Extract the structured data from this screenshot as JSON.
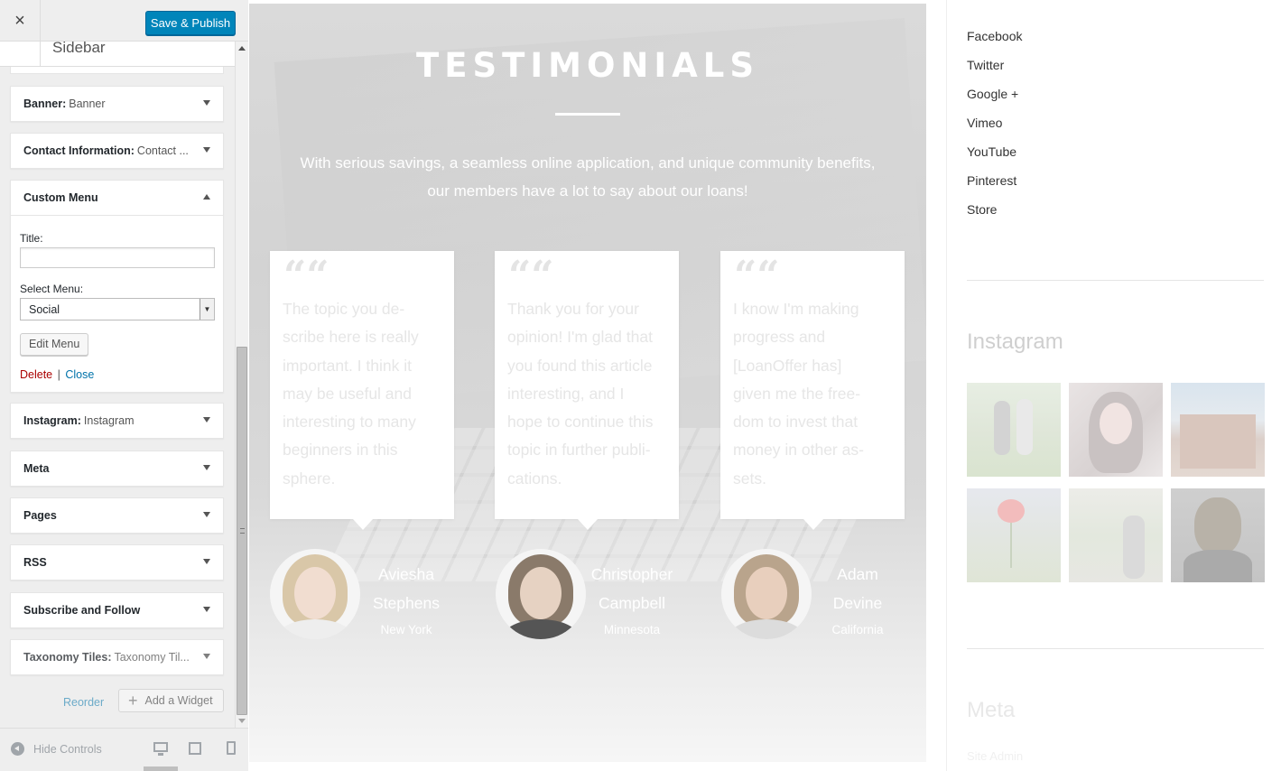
{
  "customizer": {
    "close_icon": "×",
    "publish_label": "Save & Publish",
    "section_title": "Sidebar",
    "widgets": [
      {
        "name": "Banner:",
        "subtitle": "Banner"
      },
      {
        "name": "Contact Information:",
        "subtitle": "Contact ..."
      },
      {
        "name": "Custom Menu",
        "subtitle": ""
      },
      {
        "name": "Instagram:",
        "subtitle": "Instagram"
      },
      {
        "name": "Meta",
        "subtitle": ""
      },
      {
        "name": "Pages",
        "subtitle": ""
      },
      {
        "name": "RSS",
        "subtitle": ""
      },
      {
        "name": "Subscribe and Follow",
        "subtitle": ""
      },
      {
        "name": "Taxonomy Tiles:",
        "subtitle": "Taxonomy Til..."
      }
    ],
    "custom_menu_form": {
      "title_label": "Title:",
      "title_value": "",
      "select_label": "Select Menu:",
      "select_value": "Social",
      "edit_menu_label": "Edit Menu",
      "delete_label": "Delete",
      "separator": "|",
      "close_label": "Close"
    },
    "reorder_label": "Reorder",
    "add_widget_label": "Add a Widget",
    "add_widget_icon": "+",
    "hide_controls_label": "Hide Controls"
  },
  "testimonials": {
    "title": "TESTIMONIALS",
    "intro_line1": "With serious savings, a seamless online application, and unique community benefits,",
    "intro_line2": "our members have a lot to say about our loans!",
    "quote_glyph": "““",
    "cards": [
      {
        "lines": [
          "The topic you de-",
          "scribe here is really",
          "important. I think it",
          "may be useful and",
          "interesting to many",
          "beginners in this",
          "sphere."
        ],
        "name_line1": "Aviesha",
        "name_line2": "Stephens",
        "location": "New York"
      },
      {
        "lines": [
          "Thank you for your",
          "opinion! I'm glad that",
          "you found this article",
          "interesting, and I",
          "hope to continue this",
          "topic in further publi-",
          "cations."
        ],
        "name_line1": "Christopher",
        "name_line2": "Campbell",
        "location": "Minnesota"
      },
      {
        "lines": [
          "I know I'm making",
          "progress and",
          "[LoanOffer has]",
          "given me the free-",
          "dom to invest that",
          "money in other as-",
          "sets."
        ],
        "name_line1": "Adam",
        "name_line2": "Devine",
        "location": "California"
      }
    ]
  },
  "sidebar": {
    "social_links": [
      "Facebook",
      "Twitter",
      "Google +",
      "Vimeo",
      "YouTube",
      "Pinterest",
      "Store"
    ],
    "instagram_heading": "Instagram",
    "meta_heading": "Meta",
    "meta_links": [
      "Site Admin"
    ]
  }
}
